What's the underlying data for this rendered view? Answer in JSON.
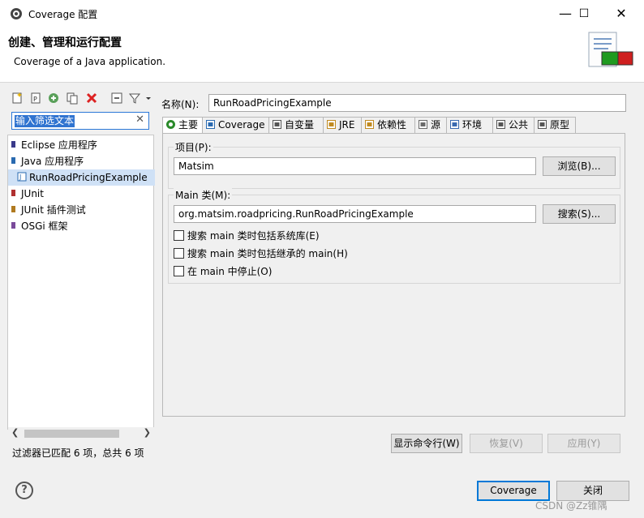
{
  "window": {
    "title": "Coverage 配置",
    "minimize_glyph": "—",
    "maximize_glyph": "☐",
    "close_glyph": "✕"
  },
  "banner": {
    "title": "创建、管理和运行配置",
    "subtitle": "Coverage of a Java application."
  },
  "left": {
    "filter_placeholder": "输入筛选文本",
    "filter_value": "输入筛选文本",
    "tree": [
      {
        "label": "Eclipse 应用程序",
        "icon": "eclipse-app-icon"
      },
      {
        "label": "Java 应用程序",
        "icon": "java-app-icon"
      },
      {
        "label": "RunRoadPricingExample",
        "icon": "java-class-icon",
        "selected": true
      },
      {
        "label": "JUnit",
        "icon": "junit-icon"
      },
      {
        "label": "JUnit 插件测试",
        "icon": "junit-plugin-icon"
      },
      {
        "label": "OSGi 框架",
        "icon": "osgi-icon"
      }
    ],
    "filter_status": "过滤器已匹配 6 项，总共 6 项"
  },
  "right": {
    "name_label": "名称(N):",
    "name_value": "RunRoadPricingExample",
    "tabs": [
      {
        "label": "主要",
        "icon": "main-tab-icon"
      },
      {
        "label": "Coverage",
        "icon": "coverage-tab-icon"
      },
      {
        "label": "自变量",
        "icon": "arguments-tab-icon"
      },
      {
        "label": "JRE",
        "icon": "jre-tab-icon"
      },
      {
        "label": "依赖性",
        "icon": "dependencies-tab-icon"
      },
      {
        "label": "源",
        "icon": "source-tab-icon"
      },
      {
        "label": "环境",
        "icon": "environment-tab-icon"
      },
      {
        "label": "公共",
        "icon": "common-tab-icon"
      },
      {
        "label": "原型",
        "icon": "prototype-tab-icon"
      }
    ],
    "project_group_label": "项目(P):",
    "project_value": "Matsim",
    "browse_button": "浏览(B)...",
    "main_group_label": "Main 类(M):",
    "main_value": "org.matsim.roadpricing.RunRoadPricingExample",
    "search_button": "搜索(S)...",
    "checkboxes": [
      {
        "label": "搜索 main 类时包括系统库(E)",
        "checked": false
      },
      {
        "label": "搜索 main 类时包括继承的 main(H)",
        "checked": false
      },
      {
        "label": "在 main 中停止(O)",
        "checked": false
      }
    ],
    "show_cmd_button": "显示命令行(W)",
    "revert_button": "恢复(V)",
    "apply_button": "应用(Y)"
  },
  "footer": {
    "coverage_button": "Coverage",
    "close_button": "关闭",
    "help_glyph": "?"
  },
  "watermark": "CSDN @Zz锥隅",
  "colors": {
    "accent": "#0078d7",
    "selection": "#3074d0",
    "tree_selected": "#cfe1f6"
  }
}
